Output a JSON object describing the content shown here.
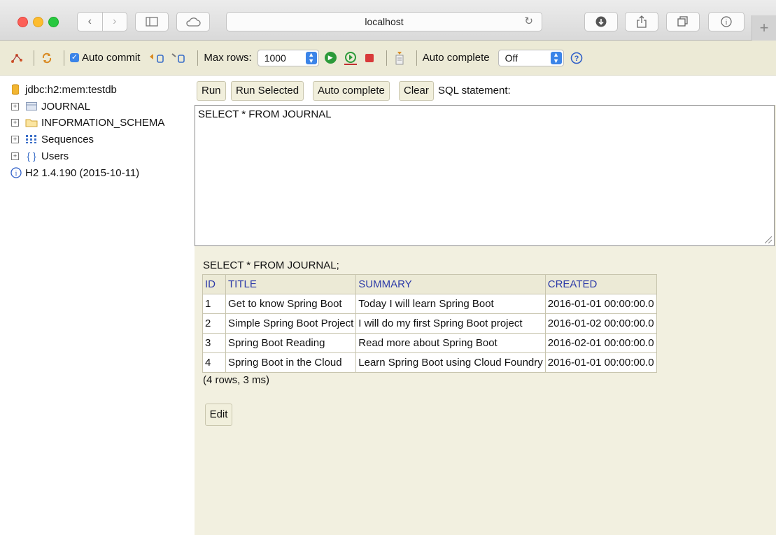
{
  "browser": {
    "url": "localhost",
    "back_glyph": "‹",
    "forward_glyph": "›",
    "new_tab_glyph": "+"
  },
  "toolbar": {
    "auto_commit_label": "Auto commit",
    "max_rows_label": "Max rows:",
    "max_rows_value": "1000",
    "auto_complete_label": "Auto complete",
    "auto_complete_value": "Off"
  },
  "tree": {
    "connection": "jdbc:h2:mem:testdb",
    "items": [
      {
        "label": "JOURNAL",
        "icon": "table-icon"
      },
      {
        "label": "INFORMATION_SCHEMA",
        "icon": "folder-icon"
      },
      {
        "label": "Sequences",
        "icon": "sequence-icon"
      },
      {
        "label": "Users",
        "icon": "users-icon"
      }
    ],
    "version": "H2 1.4.190 (2015-10-11)"
  },
  "query": {
    "buttons": {
      "run": "Run",
      "run_selected": "Run Selected",
      "auto_complete": "Auto complete",
      "clear": "Clear"
    },
    "sql_statement_label": "SQL statement:",
    "editor_text": "SELECT * FROM JOURNAL"
  },
  "results": {
    "query_echo": "SELECT * FROM JOURNAL;",
    "columns": [
      "ID",
      "TITLE",
      "SUMMARY",
      "CREATED"
    ],
    "rows": [
      [
        "1",
        "Get to know Spring Boot",
        "Today I will learn Spring Boot",
        "2016-01-01 00:00:00.0"
      ],
      [
        "2",
        "Simple Spring Boot Project",
        "I will do my first Spring Boot project",
        "2016-01-02 00:00:00.0"
      ],
      [
        "3",
        "Spring Boot Reading",
        "Read more about Spring Boot",
        "2016-02-01 00:00:00.0"
      ],
      [
        "4",
        "Spring Boot in the Cloud",
        "Learn Spring Boot using Cloud Foundry",
        "2016-01-01 00:00:00.0"
      ]
    ],
    "row_count": "(4 rows, 3 ms)",
    "edit_label": "Edit"
  },
  "colors": {
    "toolbar_bg": "#ecead6",
    "panel_bg": "#f2f0e0",
    "header_text": "#2c3aa8",
    "accent_blue": "#3b84e8"
  }
}
